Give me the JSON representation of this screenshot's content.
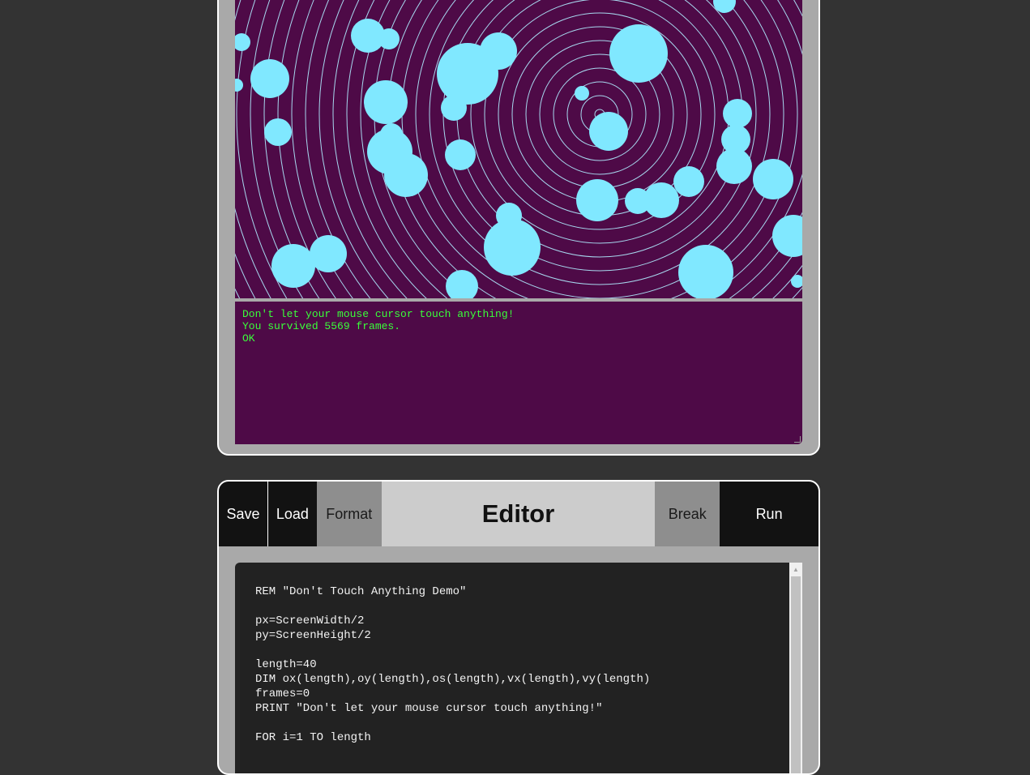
{
  "console": {
    "lines": [
      "Don't let your mouse cursor touch anything!",
      "You survived 5569 frames.",
      "OK"
    ]
  },
  "canvas": {
    "background": "#4e0a47",
    "ring_color": "#a7d8ef",
    "ball_color": "#80e8ff"
  },
  "toolbar": {
    "save_label": "Save",
    "load_label": "Load",
    "format_label": "Format",
    "title": "Editor",
    "break_label": "Break",
    "run_label": "Run"
  },
  "editor": {
    "code": "REM \"Don't Touch Anything Demo\"\n\npx=ScreenWidth/2\npy=ScreenHeight/2\n\nlength=40\nDIM ox(length),oy(length),os(length),vx(length),vy(length)\nframes=0\nPRINT \"Don't let your mouse cursor touch anything!\"\n\nFOR i=1 TO length"
  },
  "icons": {
    "scroll_up": "▲"
  }
}
